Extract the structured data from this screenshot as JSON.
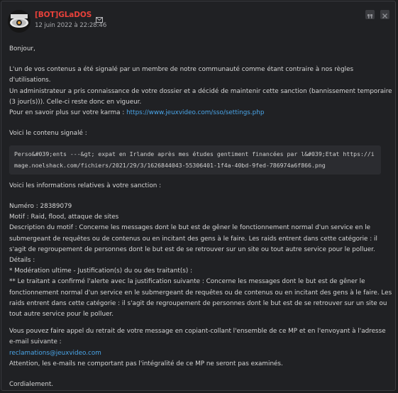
{
  "author": {
    "name": "[BOT]GLaDOS",
    "date": "12 juin 2022 à 22:28:46",
    "mail_icon": "envelope-icon",
    "name_color": "#e8413a"
  },
  "actions": [
    {
      "icon": "quote-icon"
    },
    {
      "icon": "close-icon"
    }
  ],
  "message": {
    "greeting": "Bonjour,",
    "intro_1": "L'un de vos contenus a été signalé par un membre de notre communauté comme étant contraire à nos règles d'utilisations.",
    "intro_2": "Un administrateur a pris connaissance de votre dossier et a décidé de maintenir cette sanction (bannissement temporaire (3 jour(s))). Celle-ci reste donc en vigueur.",
    "karma_prefix": "Pour en savoir plus sur votre karma : ",
    "karma_link": "https://www.jeuxvideo.com/sso/settings.php",
    "content_label": "Voici le contenu signalé :",
    "quoted_content": "Perso&#039;ents ---&gt; expat en Irlande après mes études gentiment financées par l&#039;Etat https://image.noelshack.com/fichiers/2021/29/3/1626844043-55306401-1f4a-40bd-9fed-786974a6f866.png",
    "sanction_label": "Voici les informations relatives à votre sanction :",
    "numero": "Numéro : 28389079",
    "motif": "Motif : Raid, flood, attaque de sites",
    "description": "Description du motif : Concerne les messages dont le but est de gêner le fonctionnement normal d'un service en le submergeant de requêtes ou de contenus ou en incitant des gens à le faire. Les raids entrent dans cette catégorie : il s'agit de regroupement de personnes dont le but est de se retrouver sur un site ou tout autre service pour le polluer.",
    "details_label": "Détails :",
    "details_1": "* Modération ultime - Justification(s) du ou des traitant(s) :",
    "details_2": "** Le traitant a confirmé l'alerte avec la justification suivante : Concerne les messages dont le but est de gêner le fonctionnement normal d'un service en le submergeant de requêtes ou de contenus ou en incitant des gens à le faire. Les raids entrent dans cette catégorie : il s'agit de regroupement de personnes dont le but est de se retrouver sur un site ou tout autre service pour le polluer.",
    "appeal": "Vous pouvez faire appel du retrait de votre message en copiant-collant l'ensemble de ce MP et en l'envoyant à l'adresse e-mail suivante :",
    "appeal_email": "reclamations@jeuxvideo.com",
    "warning": "Attention, les e-mails ne comportant pas l'intégralité de ce MP ne seront pas examinés.",
    "closing": "Cordialement."
  }
}
